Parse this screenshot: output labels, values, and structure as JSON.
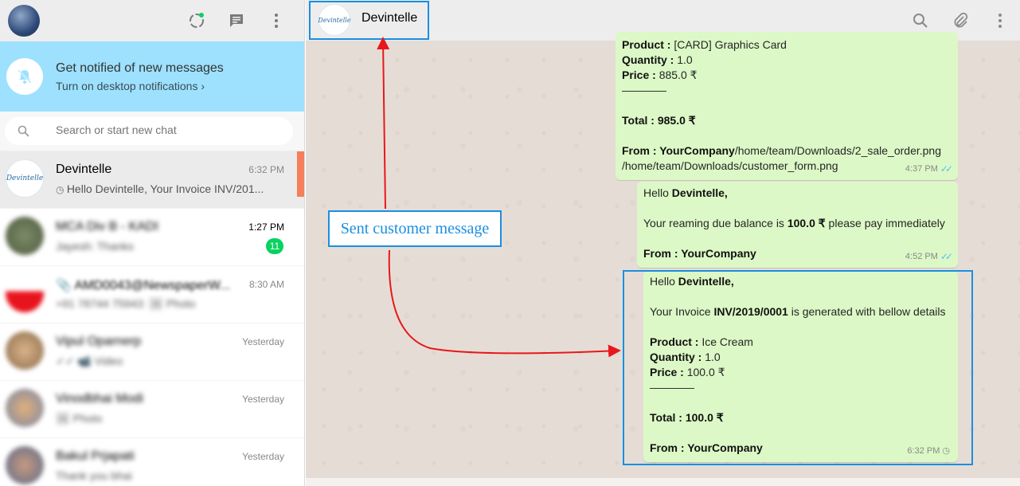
{
  "header": {
    "contact_name": "Devintelle",
    "avatar_text": "Devintelle"
  },
  "notification": {
    "title": "Get notified of new messages",
    "subtitle": "Turn on desktop notifications ›"
  },
  "search": {
    "placeholder": "Search or start new chat"
  },
  "chats": [
    {
      "name": "Devintelle",
      "time": "6:32 PM",
      "preview": "Hello Devintelle, Your Invoice INV/201..."
    },
    {
      "name": "MCA Div B - KADI",
      "time": "1:27 PM",
      "preview": "Jayesh: Thanks",
      "badge": "11"
    },
    {
      "name": "📎 AMD0043@NewspaperW...",
      "time": "8:30 AM",
      "preview": "+91 78744 75943: 🖼 Photo"
    },
    {
      "name": "Vipul Oparnerp",
      "time": "Yesterday",
      "preview": "✓✓ 📹 Video"
    },
    {
      "name": "Vinodbhai Modi",
      "time": "Yesterday",
      "preview": "🖼 Photo"
    },
    {
      "name": "Bakul Prjapati",
      "time": "Yesterday",
      "preview": "Thank you bhai"
    }
  ],
  "messages": {
    "m1": {
      "product_label": "Product :",
      "product_value": " [CARD] Graphics Card",
      "quantity_label": "Quantity :",
      "quantity_value": " 1.0",
      "price_label": "Price :",
      "price_value": " 885.0 ₹",
      "total": "Total : 985.0 ₹",
      "from_label": "From : YourCompany",
      "from_value": "/home/team/Downloads/2_sale_order.png",
      "path2": "/home/team/Downloads/customer_form.png",
      "time": "4:37 PM"
    },
    "m2": {
      "hello": "Hello ",
      "hello_name": "Devintelle,",
      "line_a": "Your reaming due balance is ",
      "line_b": "100.0 ₹",
      "line_c": " please pay immediately",
      "from": "From : YourCompany",
      "time": "4:52 PM"
    },
    "m3": {
      "hello": "Hello ",
      "hello_name": "Devintelle,",
      "line_a": "Your Invoice ",
      "line_b": "INV/2019/0001",
      "line_c": " is generated with bellow details",
      "product_label": "Product :",
      "product_value": " Ice Cream",
      "quantity_label": "Quantity :",
      "quantity_value": " 1.0",
      "price_label": "Price :",
      "price_value": " 100.0 ₹",
      "total": "Total : 100.0 ₹",
      "from": "From : YourCompany",
      "time": "6:32 PM"
    }
  },
  "annotation": {
    "label": "Sent customer message",
    "color": "#1a8fe0",
    "arrow_color": "#e8171b"
  },
  "colors": {
    "bubble": "#dcf8c6",
    "notif": "#9de1fe",
    "badge": "#09d261",
    "scroll_accent": "#f47f5b"
  },
  "icons": [
    "status-icon",
    "new-chat-icon",
    "menu-icon",
    "bell-off-icon",
    "search-icon",
    "attach-icon",
    "clock-icon",
    "double-tick-icon"
  ]
}
